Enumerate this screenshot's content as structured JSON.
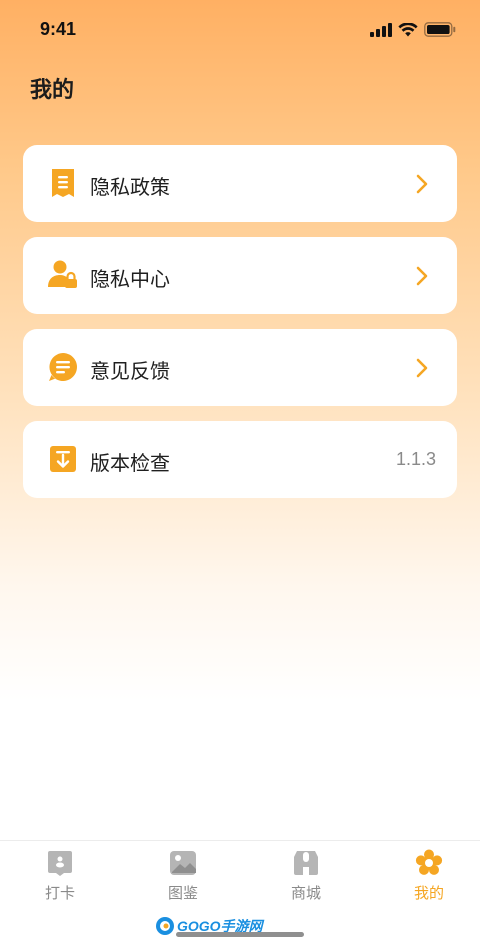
{
  "status_bar": {
    "time": "9:41"
  },
  "header": {
    "title": "我的"
  },
  "menu": [
    {
      "label": "隐私政策",
      "icon": "document-icon",
      "has_chevron": true
    },
    {
      "label": "隐私中心",
      "icon": "user-lock-icon",
      "has_chevron": true
    },
    {
      "label": "意见反馈",
      "icon": "message-icon",
      "has_chevron": true
    },
    {
      "label": "版本检查",
      "icon": "download-icon",
      "value": "1.1.3"
    }
  ],
  "tabs": [
    {
      "label": "打卡",
      "icon": "checkin-icon",
      "active": false
    },
    {
      "label": "图鉴",
      "icon": "gallery-icon",
      "active": false
    },
    {
      "label": "商城",
      "icon": "shop-icon",
      "active": false
    },
    {
      "label": "我的",
      "icon": "flower-icon",
      "active": true
    }
  ],
  "watermark": {
    "text": "GOGO手游网"
  },
  "colors": {
    "accent": "#F5A623",
    "icon_inactive": "#B5B5B5",
    "gradient_top": "#FFB063"
  }
}
